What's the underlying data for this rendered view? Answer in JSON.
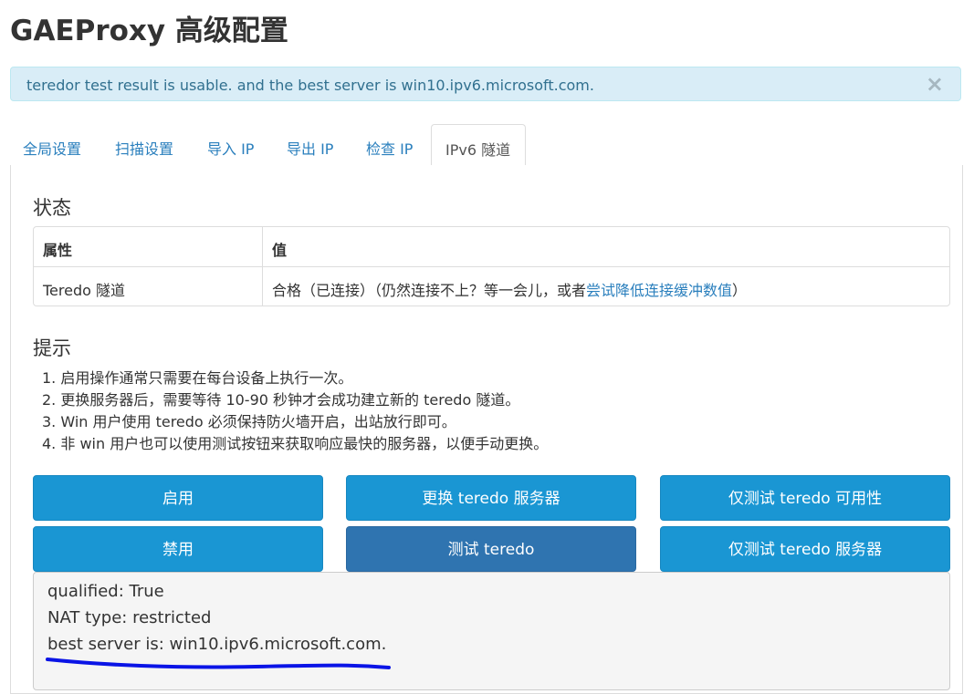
{
  "page": {
    "title": "GAEProxy 高级配置"
  },
  "alert": {
    "message": "teredor test result is usable. and the best server is win10.ipv6.microsoft.com.",
    "close_label": "×"
  },
  "tabs": [
    {
      "label": "全局设置"
    },
    {
      "label": "扫描设置"
    },
    {
      "label": "导入 IP"
    },
    {
      "label": "导出 IP"
    },
    {
      "label": "检查 IP"
    },
    {
      "label": "IPv6 隧道",
      "active": true
    }
  ],
  "status": {
    "heading": "状态",
    "columns": [
      "属性",
      "值"
    ],
    "row": {
      "name": "Teredo 隧道",
      "value_prefix": "合格（已连接）（仍然连接不上？等一会儿，或者",
      "value_link": "尝试降低连接缓冲数值",
      "value_suffix": "）"
    }
  },
  "tips": {
    "heading": "提示",
    "items": [
      "1. 启用操作通常只需要在每台设备上执行一次。",
      "2. 更换服务器后，需要等待 10-90 秒钟才会成功建立新的 teredo 隧道。",
      "3. Win 用户使用 teredo 必须保持防火墙开启，出站放行即可。",
      "4. 非 win 用户也可以使用测试按钮来获取响应最快的服务器，以便手动更换。"
    ]
  },
  "buttons": {
    "enable": "启用",
    "change_server": "更换 teredo 服务器",
    "test_usability": "仅测试 teredo 可用性",
    "disable": "禁用",
    "test_teredo": "测试 teredo",
    "test_server": "仅测试 teredo 服务器"
  },
  "output": {
    "lines": [
      "qualified: True",
      "NAT type: restricted",
      "best server is: win10.ipv6.microsoft.com."
    ]
  },
  "colors": {
    "accent": "#1a96d3",
    "accent_dark": "#2f74b0",
    "alert_bg": "#d9edf7",
    "alert_text": "#31708f",
    "link": "#2a7fbd",
    "annotation_underline": "#0a14e6"
  }
}
